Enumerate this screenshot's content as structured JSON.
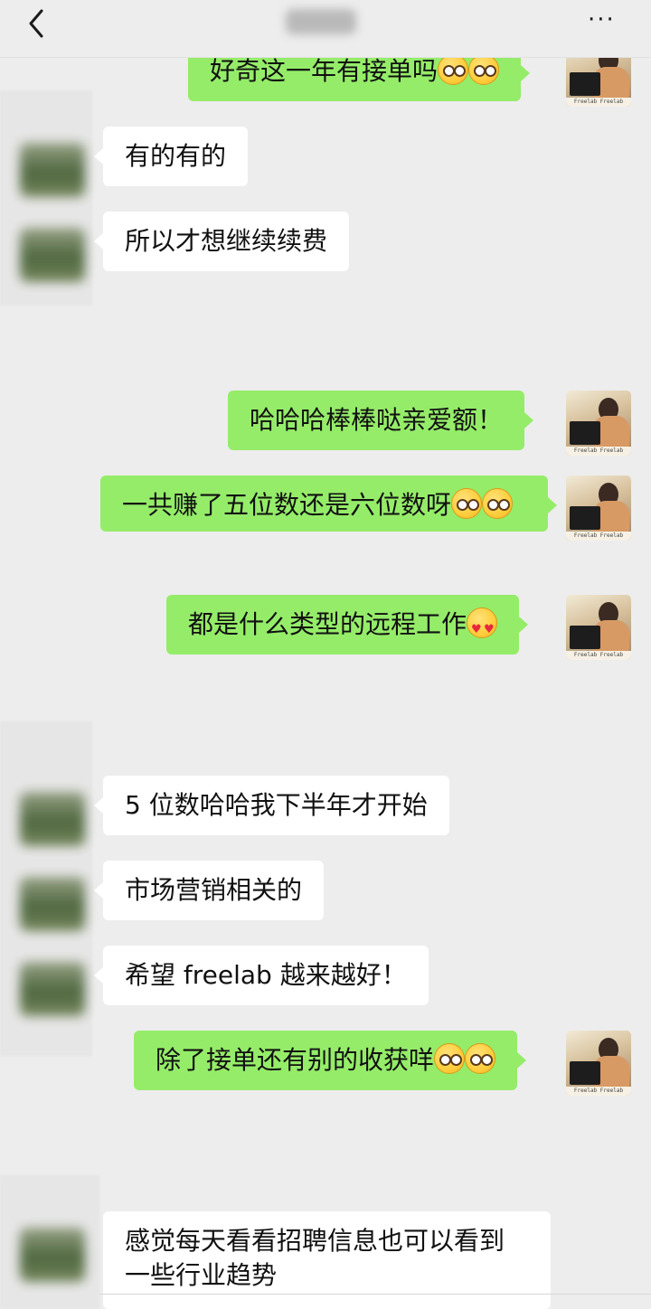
{
  "header": {
    "back_icon": "chevron-left-icon",
    "more_label": "···"
  },
  "messages": [
    {
      "side": "out",
      "text": "好奇这一年有接单吗",
      "emoji": [
        "thinking-emoji",
        "thinking-emoji"
      ]
    },
    {
      "side": "in",
      "text": "有的有的"
    },
    {
      "side": "in",
      "text": "所以才想继续续费"
    },
    {
      "side": "out",
      "text": "哈哈哈棒棒哒亲爱额！"
    },
    {
      "side": "out",
      "text": "一共赚了五位数还是六位数呀",
      "emoji": [
        "thinking-emoji",
        "thinking-emoji"
      ]
    },
    {
      "side": "out",
      "text": "都是什么类型的远程工作",
      "emoji": [
        "heart-eyes-emoji"
      ]
    },
    {
      "side": "in",
      "text": "5 位数哈哈我下半年才开始"
    },
    {
      "side": "in",
      "text": "市场营销相关的"
    },
    {
      "side": "in",
      "text": "希望 freelab 越来越好！"
    },
    {
      "side": "out",
      "text": "除了接单还有别的收获咩",
      "emoji": [
        "thinking-emoji",
        "thinking-emoji"
      ]
    },
    {
      "side": "in",
      "text": "感觉每天看看招聘信息也可以看到一些行业趋势"
    }
  ],
  "avatar_caption": "Freelab Freelab Freelab",
  "colors": {
    "background": "#ededed",
    "outgoing_bubble": "#95ec69",
    "incoming_bubble": "#ffffff"
  }
}
